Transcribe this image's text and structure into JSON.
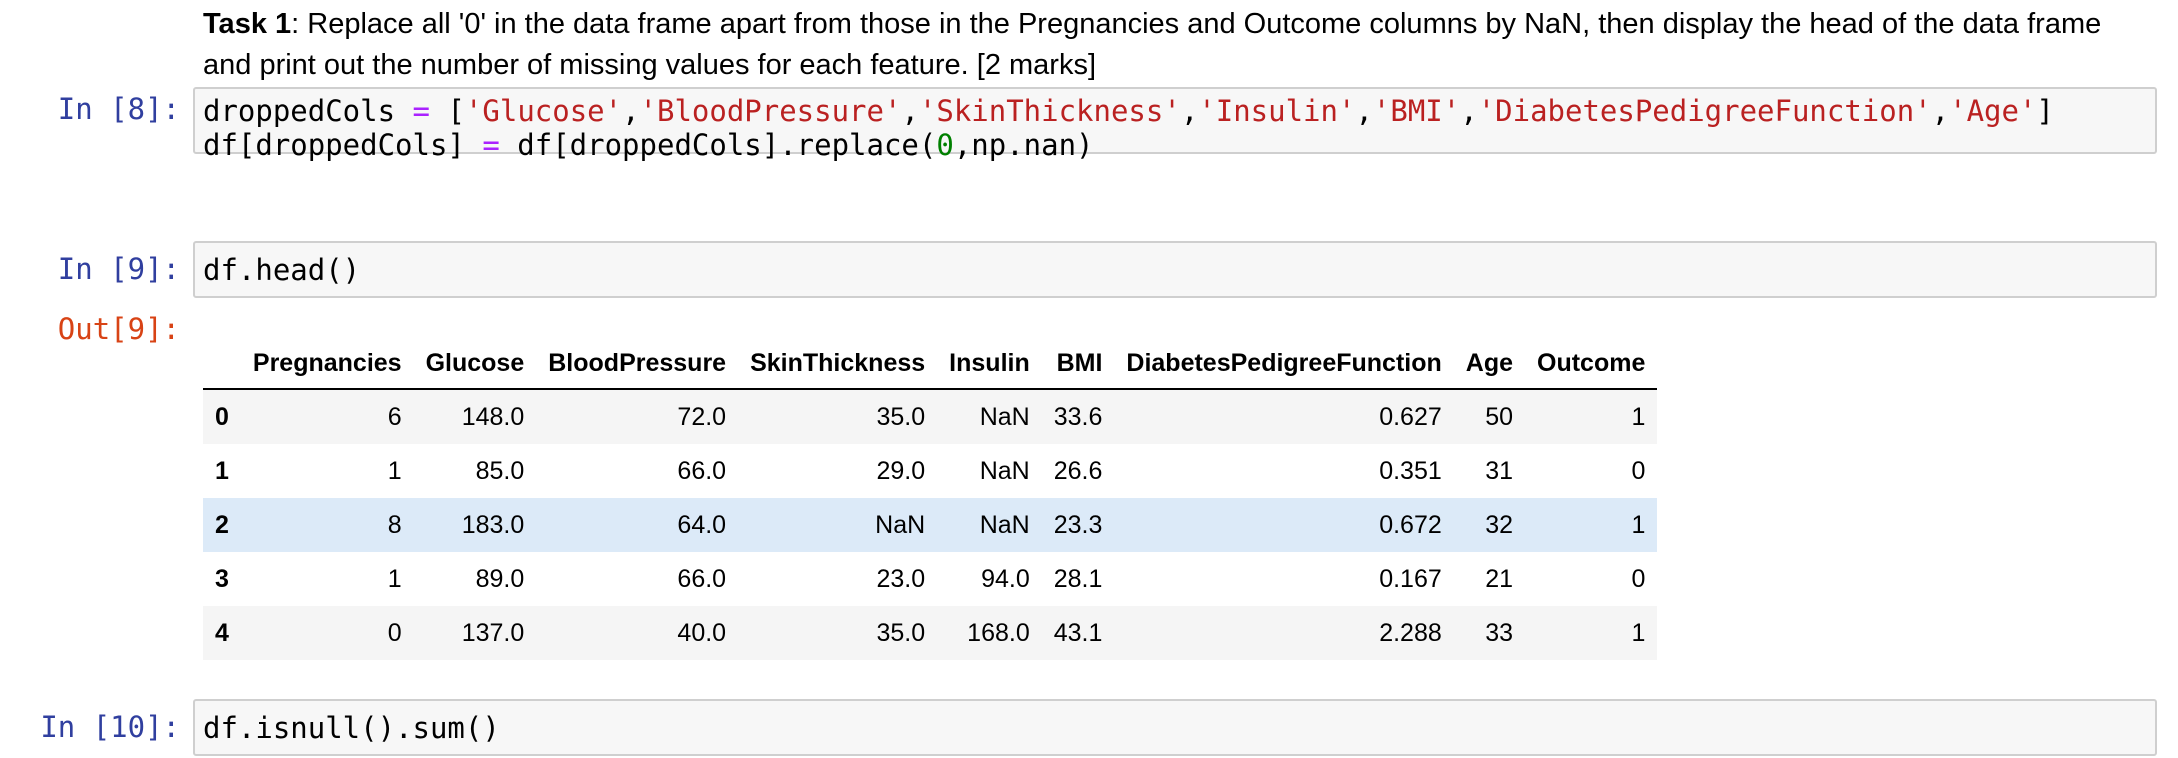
{
  "markdown": {
    "task_bold": "Task 1",
    "task_text": ": Replace all '0' in the data frame apart from those in the Pregnancies and Outcome columns by NaN, then display the head of the data frame and print out the number of missing values for each feature. [2 marks]"
  },
  "cells": {
    "c8": {
      "prompt": "In [8]:",
      "l1_var": "droppedCols",
      "l1_sp1": " ",
      "l1_eq": "=",
      "l1_sp2": " ",
      "l1_open": "[",
      "s1": "'Glucose'",
      "s2": "'BloodPressure'",
      "s3": "'SkinThickness'",
      "s4": "'Insulin'",
      "s5": "'BMI'",
      "s6": "'DiabetesPedigreeFunction'",
      "s7": "'Age'",
      "comma": ",",
      "l1_close": "]",
      "l2_a": "df[droppedCols]",
      "l2_sp1": " ",
      "l2_eq": "=",
      "l2_b": " df[droppedCols].replace(",
      "l2_num": "0",
      "l2_c": ",np.nan)"
    },
    "c9": {
      "prompt": "In [9]:",
      "code": "df.head()",
      "out_prompt": "Out[9]:"
    },
    "c10": {
      "prompt": "In [10]:",
      "code": "df.isnull().sum()"
    }
  },
  "table": {
    "columns": [
      "",
      "Pregnancies",
      "Glucose",
      "BloodPressure",
      "SkinThickness",
      "Insulin",
      "BMI",
      "DiabetesPedigreeFunction",
      "Age",
      "Outcome"
    ],
    "rows": [
      [
        "0",
        "6",
        "148.0",
        "72.0",
        "35.0",
        "NaN",
        "33.6",
        "0.627",
        "50",
        "1"
      ],
      [
        "1",
        "1",
        "85.0",
        "66.0",
        "29.0",
        "NaN",
        "26.6",
        "0.351",
        "31",
        "0"
      ],
      [
        "2",
        "8",
        "183.0",
        "64.0",
        "NaN",
        "NaN",
        "23.3",
        "0.672",
        "32",
        "1"
      ],
      [
        "3",
        "1",
        "89.0",
        "66.0",
        "23.0",
        "94.0",
        "28.1",
        "0.167",
        "21",
        "0"
      ],
      [
        "4",
        "0",
        "137.0",
        "40.0",
        "35.0",
        "168.0",
        "43.1",
        "2.288",
        "33",
        "1"
      ]
    ]
  },
  "colors": {
    "in_prompt": "#303F9F",
    "out_prompt": "#D84315",
    "string": "#BA2121",
    "operator": "#AA22FF",
    "number": "#008000",
    "hover_row": "#dceaf8"
  }
}
